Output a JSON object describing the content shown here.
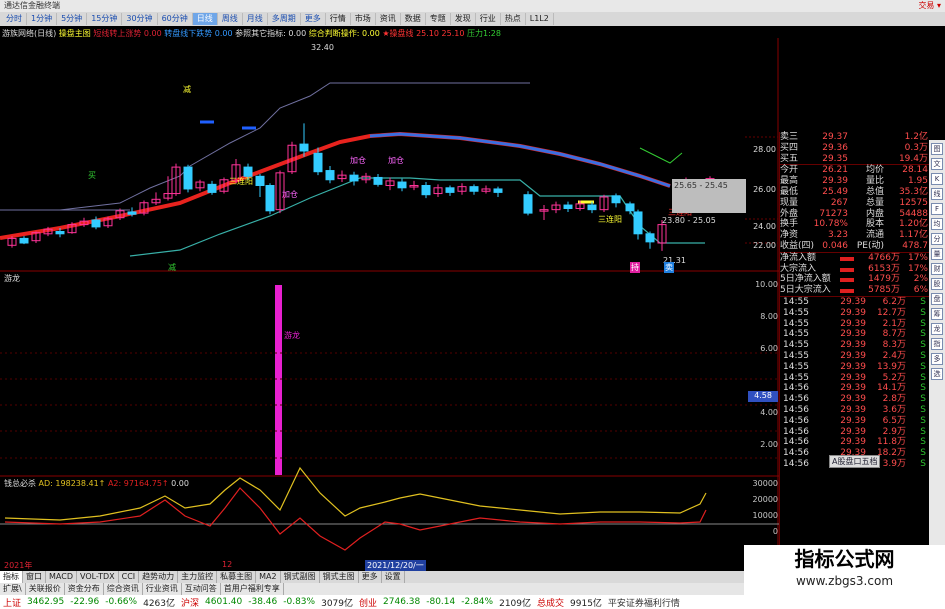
{
  "titlebar": {
    "title": "通达信金融终端",
    "right": "交易 ▾"
  },
  "menu": {
    "periods": [
      "分时",
      "1分钟",
      "5分钟",
      "15分钟",
      "30分钟",
      "60分钟",
      "日线",
      "周线",
      "月线",
      "多周期",
      "更多"
    ],
    "active_period": "日线",
    "items": [
      "行情",
      "市场",
      "资讯",
      "数据",
      "专题",
      "发现",
      "行业",
      "热点",
      "L1L2"
    ]
  },
  "main_legend": {
    "stock": "游族网络(日线)",
    "main": "操盘主图",
    "i1": "短线转上涨势 0.00",
    "i2": "转盘线下跌势 0.00",
    "i3": "参照其它指标: 0.00",
    "i4": "综合判断操作: 0.00",
    "i5": "★操盘线 25.10",
    "i6": "25.10",
    "i7": "压力1:28"
  },
  "price_axis": [
    "28.00",
    "26.00",
    "24.00",
    "22.00"
  ],
  "annotations": {
    "high": "32.40",
    "low": "21.31",
    "a1": "三连阳",
    "a2": "加仓",
    "a3": "加仓",
    "a4": "加仓",
    "a5": "三连阳",
    "a6": "三连阳",
    "a7": "减",
    "a8": "减",
    "a9": "持",
    "a10": "卖",
    "buy": "买",
    "range1": "25.65 - 25.45",
    "range2": "23.80 - 25.05"
  },
  "sub1": {
    "title": "游龙",
    "bar_label": "游龙",
    "axis": [
      "10.00",
      "8.00",
      "6.00",
      "4.00",
      "2.00"
    ],
    "value_box": "4.58"
  },
  "sub2": {
    "title": "钱总必杀",
    "ad": "AD: 198238.41↑",
    "a2": "A2: 97164.75↑",
    "a3": "0.00",
    "axis": [
      "30000",
      "20000",
      "10000",
      "0"
    ]
  },
  "date_axis": {
    "d1": "2021年",
    "d2": "12",
    "d3": "2021/12/20/一"
  },
  "quote": {
    "sell3": {
      "label": "卖三",
      "price": "29.37",
      "vol": "1.2亿"
    },
    "buy4": {
      "label": "买四",
      "price": "29.36",
      "vol": "0.3万"
    },
    "buy5": {
      "label": "买五",
      "price": "29.35",
      "vol": "19.4万"
    },
    "open": {
      "label": "今开",
      "value": "26.21",
      "label2": "均价",
      "value2": "28.14"
    },
    "high": {
      "label": "最高",
      "value": "29.39",
      "label2": "量比",
      "value2": "1.95"
    },
    "low": {
      "label": "最低",
      "value": "25.49",
      "label2": "总值",
      "value2": "35.3亿"
    },
    "now": {
      "label": "现量",
      "value": "267",
      "label2": "总量",
      "value2": "12575"
    },
    "outside": {
      "label": "外盘",
      "value": "71273",
      "label2": "内盘",
      "value2": "54488"
    },
    "turnover": {
      "label": "换手",
      "value": "10.78%",
      "label2": "股本",
      "value2": "1.20亿"
    },
    "nav": {
      "label": "净资",
      "value": "3.23",
      "label2": "流通",
      "value2": "1.17亿"
    },
    "eps": {
      "label": "收益(四)",
      "value": "0.046",
      "label2": "PE(动)",
      "value2": "478.7"
    }
  },
  "flows": [
    {
      "label": "净流入额",
      "value": "4766万",
      "pct": "17%"
    },
    {
      "label": "大宗流入",
      "value": "6153万",
      "pct": "17%"
    },
    {
      "label": "5日净流入额",
      "value": "1479万",
      "pct": "2%"
    },
    {
      "label": "5日大宗流入",
      "value": "5785万",
      "pct": "6%"
    }
  ],
  "ticks": [
    {
      "t": "14:55",
      "p": "29.39",
      "v": "6.2万",
      "s": "S"
    },
    {
      "t": "14:55",
      "p": "29.39",
      "v": "12.7万",
      "s": "S"
    },
    {
      "t": "14:55",
      "p": "29.39",
      "v": "2.1万",
      "s": "S"
    },
    {
      "t": "14:55",
      "p": "29.39",
      "v": "8.7万",
      "s": "S"
    },
    {
      "t": "14:55",
      "p": "29.39",
      "v": "8.3万",
      "s": "S"
    },
    {
      "t": "14:55",
      "p": "29.39",
      "v": "2.4万",
      "s": "S"
    },
    {
      "t": "14:55",
      "p": "29.39",
      "v": "13.9万",
      "s": "S"
    },
    {
      "t": "14:55",
      "p": "29.39",
      "v": "5.2万",
      "s": "S"
    },
    {
      "t": "14:56",
      "p": "29.39",
      "v": "14.1万",
      "s": "S"
    },
    {
      "t": "14:56",
      "p": "29.39",
      "v": "2.8万",
      "s": "S"
    },
    {
      "t": "14:56",
      "p": "29.39",
      "v": "3.6万",
      "s": "S"
    },
    {
      "t": "14:56",
      "p": "29.39",
      "v": "6.5万",
      "s": "S"
    },
    {
      "t": "14:56",
      "p": "29.39",
      "v": "2.9万",
      "s": "S"
    },
    {
      "t": "14:56",
      "p": "29.39",
      "v": "11.8万",
      "s": "S"
    },
    {
      "t": "14:56",
      "p": "29.39",
      "v": "18.2万",
      "s": "S"
    },
    {
      "t": "14:56",
      "p": "29.39",
      "v": "3.9万",
      "s": "S"
    }
  ],
  "popup": "A股盘口五档",
  "tabs": [
    "指标",
    "窗口",
    "MACD",
    "VOL-TDX",
    "CCI",
    "趋势动力",
    "主力监控",
    "私募主图",
    "MA2",
    "钢式副图",
    "钢式主图",
    "更多",
    "设置"
  ],
  "tabs2": [
    "扩展\\",
    "关联报价",
    "资金分布",
    "综合资讯",
    "行业资讯",
    "互动问答",
    "首用户福利专享"
  ],
  "statusbar": {
    "sh_label": "上证",
    "sh": "3462.95",
    "sh_chg": "-22.96",
    "sh_pct": "-0.66%",
    "sh_amt": "4263亿",
    "sz_label": "沪深",
    "sz": "4601.40",
    "sz_chg": "-38.46",
    "sz_pct": "-0.83%",
    "sz_amt": "3079亿",
    "cy_label": "创业",
    "cy": "2746.38",
    "cy_chg": "-80.14",
    "cy_pct": "-2.84%",
    "cy_amt": "2109亿",
    "total_label": "总成交",
    "total": "9915亿",
    "broker": "平安证券福利行情"
  },
  "watermark": {
    "line1": "指标公式网",
    "line2": "www.zbgs3.com"
  },
  "tools": [
    "图",
    "文",
    "K",
    "线",
    "F",
    "均",
    "分",
    "量",
    "财",
    "股",
    "盘",
    "筹",
    "龙",
    "指",
    "多",
    "选"
  ],
  "colors": {
    "up": "#ff3399",
    "down": "#33ccff",
    "ma_red": "#e8231e",
    "ma_blue": "#3a6ee0",
    "teal": "#38b0a8",
    "magenta": "#e820d0"
  }
}
